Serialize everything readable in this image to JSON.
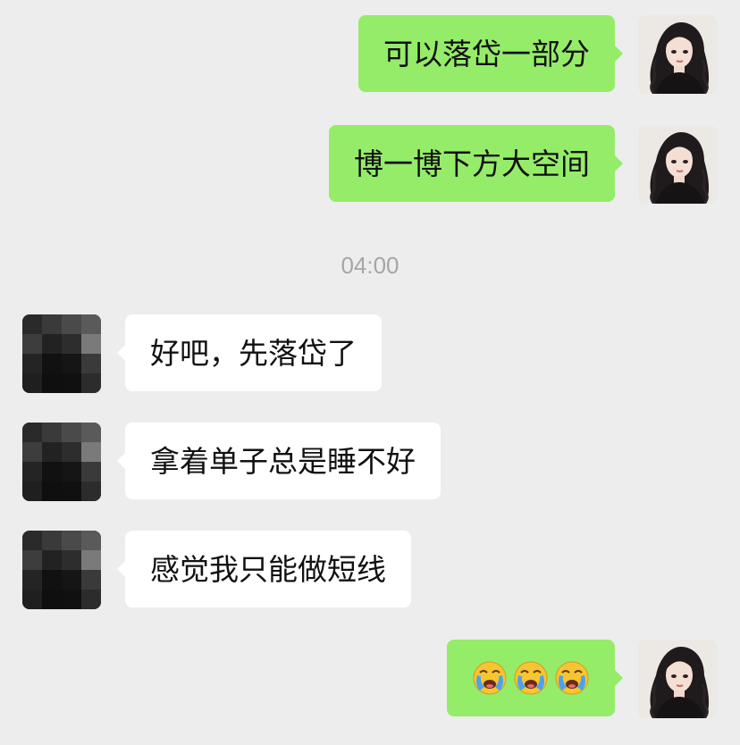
{
  "chat": {
    "timestamp": "04:00",
    "messages": [
      {
        "sender": "self",
        "text": "可以落岱一部分"
      },
      {
        "sender": "self",
        "text": "博一博下方大空间"
      },
      {
        "sender": "other",
        "text": "好吧，先落岱了"
      },
      {
        "sender": "other",
        "text": "拿着单子总是睡不好"
      },
      {
        "sender": "other",
        "text": "感觉我只能做短线"
      },
      {
        "sender": "self",
        "emojis": [
          "crying-face",
          "crying-face",
          "crying-face"
        ]
      }
    ]
  },
  "colors": {
    "background": "#ededed",
    "self_bubble": "#95ec69",
    "other_bubble": "#ffffff",
    "timestamp": "#a6a6a6"
  },
  "icons": {
    "self_avatar": "anime-girl-avatar",
    "other_avatar": "pixelated-avatar",
    "emoji": "loudly-crying-face-emoji"
  }
}
